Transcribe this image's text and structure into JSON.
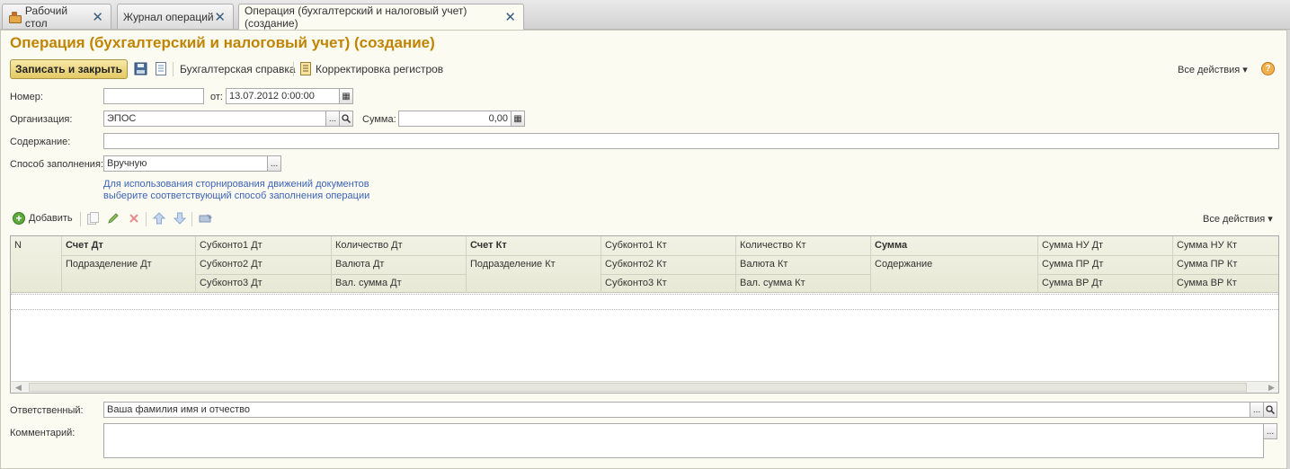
{
  "tabs": [
    {
      "label": "Рабочий стол",
      "close": "✕"
    },
    {
      "label": "Журнал операций",
      "close": "✕"
    },
    {
      "label": "Операция (бухгалтерский и налоговый учет) (создание)",
      "close": "✕"
    }
  ],
  "page_title": "Операция (бухгалтерский и налоговый учет) (создание)",
  "toolbar": {
    "save_close": "Записать и закрыть",
    "accounting_ref": "Бухгалтерская справка",
    "registers_adjust": "Корректировка регистров",
    "all_actions": "Все действия",
    "help": "?"
  },
  "form": {
    "number_label": "Номер:",
    "number_value": "",
    "date_label": "от:",
    "date_value": "13.07.2012  0:00:00",
    "org_label": "Организация:",
    "org_value": "ЭПОС",
    "sum_label": "Сумма:",
    "sum_value": "0,00",
    "content_label": "Содержание:",
    "content_value": "",
    "fill_method_label": "Способ заполнения:",
    "fill_method_value": "Вручную",
    "hint_line1": "Для использования сторнирования движений документов",
    "hint_line2": "выберите соответствующий способ заполнения операции",
    "responsible_label": "Ответственный:",
    "responsible_value": "Ваша фамилия имя и отчество",
    "comment_label": "Комментарий:",
    "comment_value": ""
  },
  "table_toolbar": {
    "add": "Добавить",
    "all_actions": "Все действия"
  },
  "table": {
    "headers": {
      "n": "N",
      "c1": [
        "Счет Дт",
        "Подразделение Дт",
        ""
      ],
      "c2": [
        "Субконто1 Дт",
        "Субконто2 Дт",
        "Субконто3 Дт"
      ],
      "c3": [
        "Количество Дт",
        "Валюта Дт",
        "Вал. сумма Дт"
      ],
      "c4": [
        "Счет Кт",
        "Подразделение Кт",
        ""
      ],
      "c5": [
        "Субконто1 Кт",
        "Субконто2 Кт",
        "Субконто3 Кт"
      ],
      "c6": [
        "Количество Кт",
        "Валюта Кт",
        "Вал. сумма Кт"
      ],
      "c7": [
        "Сумма",
        "Содержание",
        ""
      ],
      "c8": [
        "Сумма НУ Дт",
        "Сумма ПР Дт",
        "Сумма ВР Дт"
      ],
      "c9": [
        "Сумма НУ Кт",
        "Сумма ПР Кт",
        "Сумма ВР Кт"
      ]
    },
    "rows": []
  },
  "glyphs": {
    "ellipsis": "...",
    "search": "🔍",
    "calendar": "▦",
    "calc": "▦",
    "dropdown": "▾",
    "scroll_left": "◀",
    "scroll_right": "▶"
  }
}
